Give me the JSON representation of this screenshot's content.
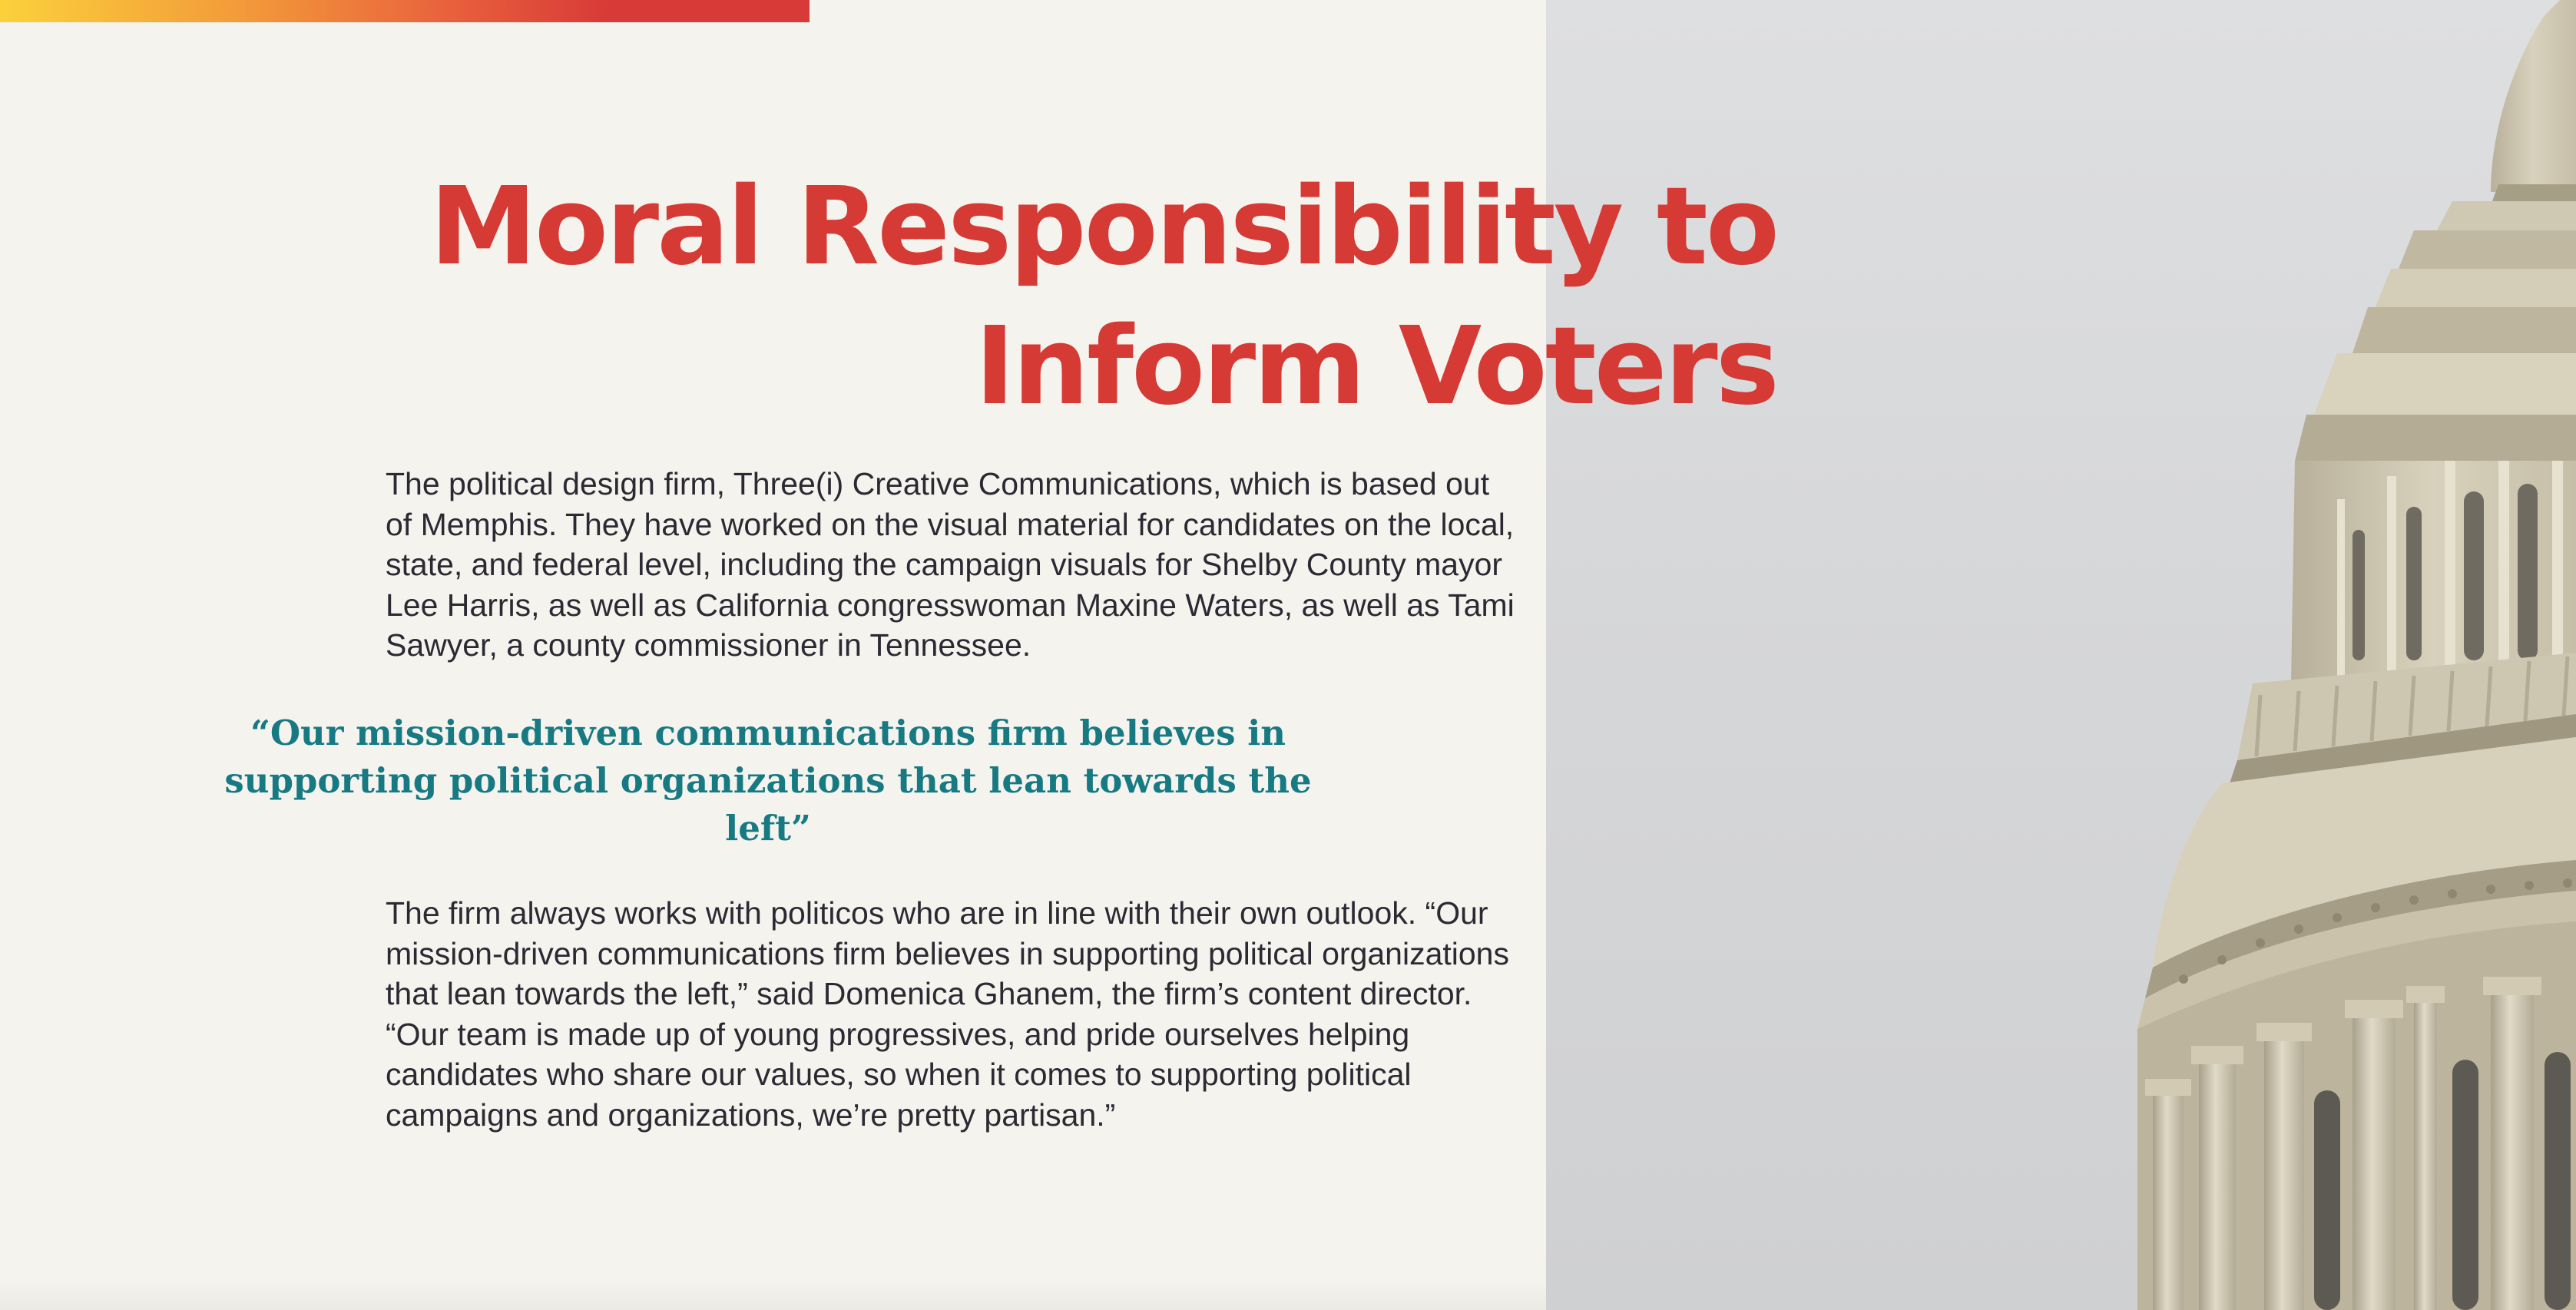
{
  "article": {
    "headline_line1": "Moral Responsibility to",
    "headline_line2": "Inform Voters",
    "paragraph_1": "The political design firm, Three(i) Creative Communications, which is based out of Memphis. They have worked on the visual material for candidates on the local, state, and federal level, including the campaign visuals for Shelby County mayor Lee Harris, as well as California congresswoman Maxine Waters, as well as Tami Sawyer, a county commissioner in Tennessee.",
    "pull_quote": "“Our mission-driven communications firm believes in supporting political organizations that lean towards the left”",
    "paragraph_2": "The firm always works with politicos who are in line with their own outlook. “Our mission-driven communications firm believes in supporting political organizations that lean towards the left,” said Domenica Ghanem, the firm’s content director. “Our team is made up of young progressives, and pride ourselves helping candidates who share our values, so when it comes to supporting political campaigns and organizations, we’re pretty partisan.”"
  },
  "colors": {
    "headline": "#d63a35",
    "pull_quote": "#177a83",
    "body_text": "#2b2a33",
    "background": "#f5f3ee",
    "accent_gradient": [
      "#fbd13b",
      "#f39a3a",
      "#e9623c",
      "#d83a37"
    ]
  },
  "image": {
    "subject": "capitol-dome-photo"
  }
}
